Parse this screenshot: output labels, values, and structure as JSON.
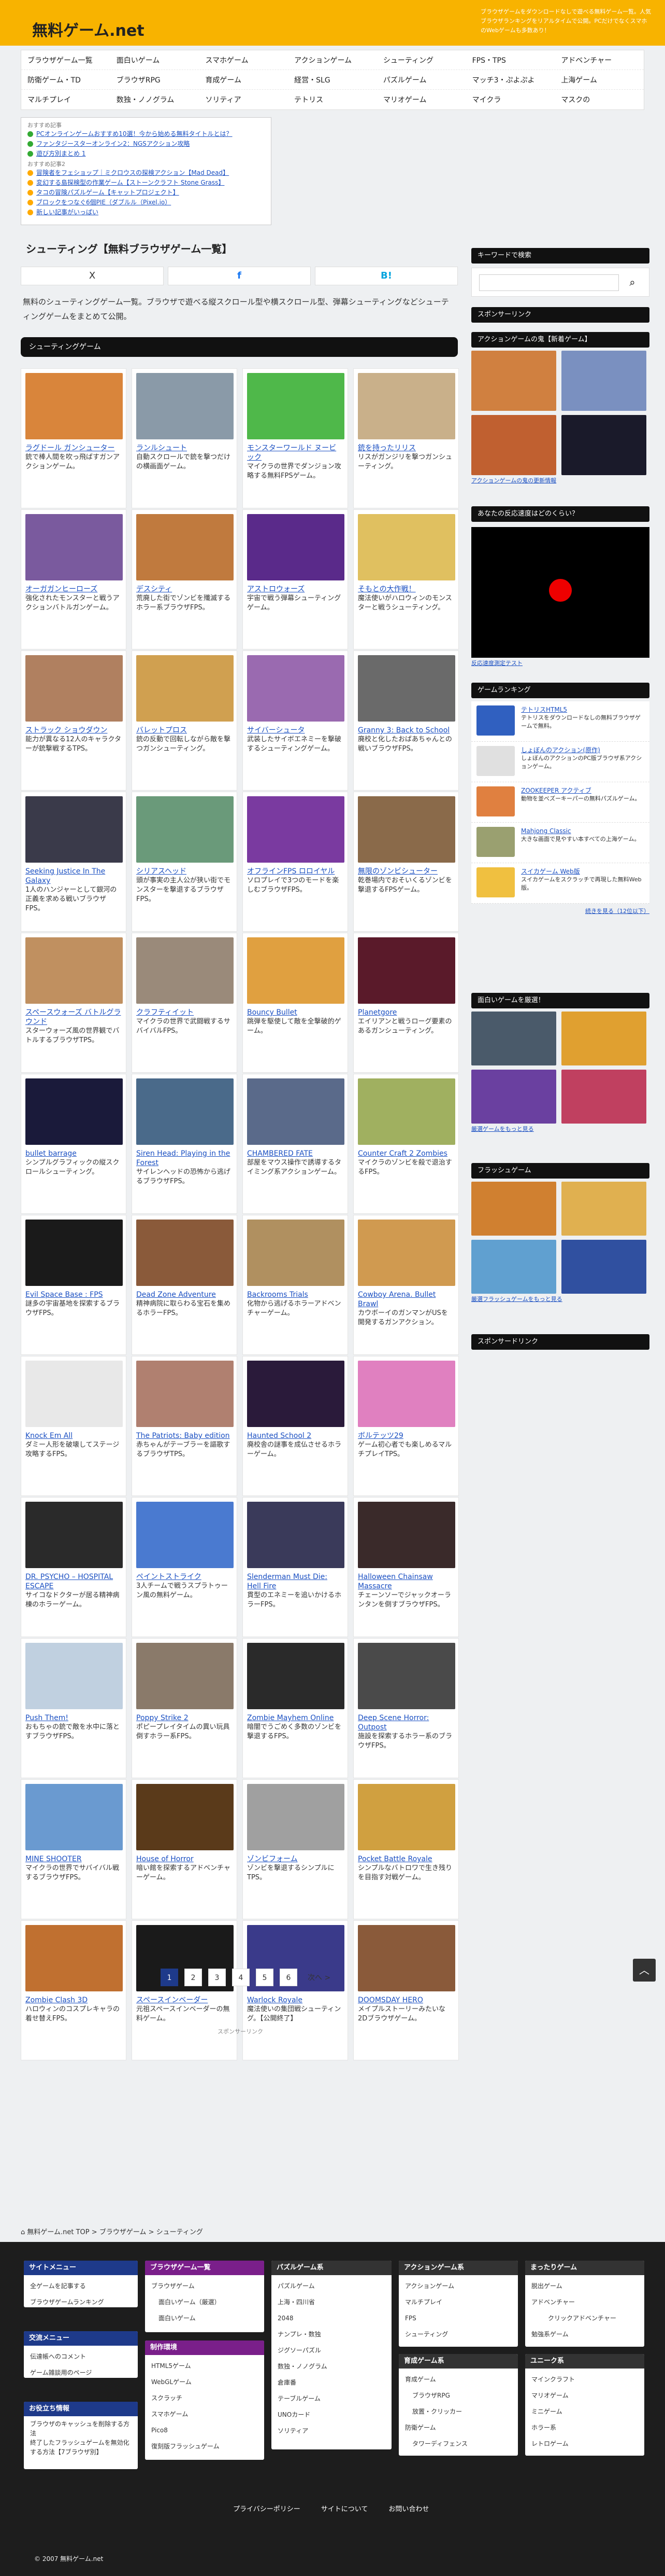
{
  "header": {
    "title": "無料ゲーム.net",
    "tagline": "ブラウザゲームをダウンロードなしで遊べる無料ゲーム一覧。人気ブラウザランキングをリアルタイムで公開。PCだけでなくスマホのWebゲームも多数あり！"
  },
  "gnav": [
    [
      "ブラウザゲーム一覧",
      "面白いゲーム",
      "スマホゲーム",
      "アクションゲーム",
      "シューティング",
      "FPS・TPS",
      "アドベンチャー"
    ],
    [
      "防衛ゲーム・TD",
      "ブラウザRPG",
      "育成ゲーム",
      "経営・SLG",
      "パズルゲーム",
      "マッチ3・ぷよぷよ",
      "上海ゲーム"
    ],
    [
      "マルチプレイ",
      "数独・ノノグラム",
      "ソリティア",
      "テトリス",
      "マリオゲーム",
      "マイクラ",
      "マスクの"
    ]
  ],
  "notice": {
    "head1": "おすすめ記事",
    "items1": [
      {
        "text": "PCオンラインゲームおすすめ10選！今から始める無料タイトルとは？",
        "color": "#33aa33"
      },
      {
        "text": "ファンタジースターオンライン2：NGSアクション攻略",
        "color": "#33aa33"
      },
      {
        "text": "遊び方別まとめ 1",
        "color": "#33aa33"
      }
    ],
    "head2": "おすすめ記事2",
    "items2": [
      {
        "text": "冒険者をフェショップ｜ミクロウスの探検アクション【Mad Dead】",
        "color": "#ffaa00"
      },
      {
        "text": "変幻する島探検型の作業ゲーム【ストーンクラフト Stone Grass】",
        "color": "#ffaa00"
      },
      {
        "text": "タコの冒険パズルゲーム【キャットプロジェクト】",
        "color": "#ffaa00"
      },
      {
        "text": "ブロックをつなぐ6個PIE（ダブルル（Pixel.io）",
        "color": "#ffaa00"
      },
      {
        "text": "新しい記事がいっぱい",
        "color": "#ffaa00"
      }
    ]
  },
  "main": {
    "h1": "シューティング【無料ブラウザゲーム一覧】",
    "share": {
      "x": "X",
      "fb": "f",
      "hb": "B!"
    },
    "intro": "無料のシューティングゲーム一覧。ブラウザで遊べる縦スクロール型や横スクロール型、弾幕シューティングなどシューティングゲームをまとめて公開。",
    "section": "シューティングゲーム"
  },
  "games": [
    {
      "title": "ラグドール ガンシューター",
      "desc": "銃で棒人間を吹っ飛ばすガンアクションゲーム。",
      "color": "#d9853b"
    },
    {
      "title": "ランルシュート",
      "desc": "自動スクロールで銃を撃つだけの横画面ゲーム。",
      "color": "#8a9aa8"
    },
    {
      "title": "モンスターワールド ヌービック",
      "desc": "マイクラの世界でダンジョン攻略する無料FPSゲーム。",
      "color": "#4fb84a"
    },
    {
      "title": "銃を持ったリリス",
      "desc": "リスがガンジリを撃つガンシューティング。",
      "color": "#c9b08a"
    },
    {
      "title": "オーガガンヒーローズ",
      "desc": "強化されたモンスターと戦うアクションバトルガンゲーム。",
      "color": "#7a5a9e"
    },
    {
      "title": "デスシティ",
      "desc": "荒廃した街でゾンビを殲滅するホラー系ブラウザFPS。",
      "color": "#c07a3e"
    },
    {
      "title": "アストロウォーズ",
      "desc": "宇宙で戦う弾幕シューティングゲーム。",
      "color": "#5a2a8a"
    },
    {
      "title": "そもとの大作戦！",
      "desc": "魔法使いがハロウィンのモンスターと戦うシューティング。",
      "color": "#e0c060"
    },
    {
      "title": "ストラック ショウダウン",
      "desc": "能力が異なる12人のキャラクターが銃撃戦するTPS。",
      "color": "#b08060"
    },
    {
      "title": "バレットプロス",
      "desc": "銃の反動で回転しながら敵を撃つガンシューティング。",
      "color": "#d0a050"
    },
    {
      "title": "サイバーシュータ",
      "desc": "武装したサイボエネミーを撃破するシューティングゲーム。",
      "color": "#9a6ab0"
    },
    {
      "title": "Granny 3: Back to School",
      "desc": "廃校と化したおばあちゃんとの戦いブラウザFPS。",
      "color": "#6a6a6a"
    },
    {
      "title": "Seeking Justice In The Galaxy",
      "desc": "1人のハンジャーとして銀河の正義を求める戦いブラウザFPS。",
      "color": "#3a3a4a"
    },
    {
      "title": "シリアスヘッド",
      "desc": "頭が事実の主人公が狭い街でモンスターを撃退するブラウザFPS。",
      "color": "#6a9a7a"
    },
    {
      "title": "オフラインFPS ロロイヤル",
      "desc": "ソロプレイで3つのモードを楽しむブラウザFPS。",
      "color": "#7a3aa0"
    },
    {
      "title": "無限のゾンビシューター",
      "desc": "乾巻場内でおそいくるゾンビを撃退するFPSゲーム。",
      "color": "#8a6a4a"
    },
    {
      "title": "スペースウォーズ バトルグラウンド",
      "desc": "スターウォーズ風の世界観でバトルするブラウザTPS。",
      "color": "#c09060"
    },
    {
      "title": "クラフティイット",
      "desc": "マイクラの世界で武闘戦するサバイバルFPS。",
      "color": "#9a8a7a"
    },
    {
      "title": "Bouncy Bullet",
      "desc": "跳弾を駆使して敵を全撃破的ゲーム。",
      "color": "#e0a040"
    },
    {
      "title": "Planetgore",
      "desc": "エイリアンと戦うローグ要素のあるガンシューティング。",
      "color": "#5a1a2a"
    },
    {
      "title": "bullet barrage",
      "desc": "シンプルグラフィックの縦スクロールシューティング。",
      "color": "#1a1a3a"
    },
    {
      "title": "Siren Head: Playing in the Forest",
      "desc": "サイレンヘッドの恐怖から逃げるブラウザFPS。",
      "color": "#4a6a8a"
    },
    {
      "title": "CHAMBERED FATE",
      "desc": "部屋をマウス操作で誘導するタイミング系アクションゲーム。",
      "color": "#5a6a8a"
    },
    {
      "title": "Counter Craft 2 Zombies",
      "desc": "マイクラのゾンビを殺で退治するFPS。",
      "color": "#a0b060"
    },
    {
      "title": "Evil Space Base : FPS",
      "desc": "謎多の宇宙基地を探索するブラウザFPS。",
      "color": "#1a1a1a"
    },
    {
      "title": "Dead Zone Adventure",
      "desc": "精神病院に取らわる宝石を集めるホラーFPS。",
      "color": "#8a5a3a"
    },
    {
      "title": "Backrooms Trials",
      "desc": "化物から逃げるホラーアドベンチャーゲーム。",
      "color": "#b09060"
    },
    {
      "title": "Cowboy Arena. Bullet Brawl",
      "desc": "カウボーイのガンマンがUSを開発するガンアクション。",
      "color": "#d09a50"
    },
    {
      "title": "Knock Em All",
      "desc": "ダミー人形を破壊してステージ攻略するFPS。",
      "color": "#e8e8e8"
    },
    {
      "title": "The Patriots: Baby edition",
      "desc": "赤ちゃんがテーブラーを謳歌するブラウザTPS。",
      "color": "#b08070"
    },
    {
      "title": "Haunted School 2",
      "desc": "廃校舎の謎事を成仏させるホラーゲーム。",
      "color": "#2a1a3a"
    },
    {
      "title": "ボルテッツ29",
      "desc": "ゲーム初心者でも楽しめるマルチプレイTPS。",
      "color": "#e080c0"
    },
    {
      "title": "DR. PSYCHO – HOSPITAL ESCAPE",
      "desc": "サイコなドクターが居る精神病棟のホラーゲーム。",
      "color": "#2a2a2a"
    },
    {
      "title": "ペイントストライク",
      "desc": "3人チームで戦うスプラトゥーン風の無料ゲーム。",
      "color": "#4a7ad0"
    },
    {
      "title": "Slenderman Must Die: Hell Fire",
      "desc": "貫型のエネミーを追いかけるホラーFPS。",
      "color": "#3a3a5a"
    },
    {
      "title": "Halloween Chainsaw Massacre",
      "desc": "チェーンソーでジャックオーランタンを倒すブラウザFPS。",
      "color": "#3a2a2a"
    },
    {
      "title": "Push Them!",
      "desc": "おもちゃの銃で敵を水中に落とすブラウザFPS。",
      "color": "#c0d0e0"
    },
    {
      "title": "Poppy Strike 2",
      "desc": "ポピープレイタイムの異い玩具倒すホラー系FPS。",
      "color": "#8a7a6a"
    },
    {
      "title": "Zombie Mayhem Online",
      "desc": "暗闇でうごめく多数のゾンビを撃退するFPS。",
      "color": "#2a2a2a"
    },
    {
      "title": "Deep Scene Horror: Outpost",
      "desc": "施設を探索するホラー系のブラウザFPS。",
      "color": "#4a4a4a"
    },
    {
      "title": "MINE SHOOTER",
      "desc": "マイクラの世界でサバイバル戦するブラウザFPS。",
      "color": "#6a9ad0"
    },
    {
      "title": "House of Horror",
      "desc": "暗い館を探索するアドベンチャーゲーム。",
      "color": "#5a3a1a"
    },
    {
      "title": "ゾンビフォーム",
      "desc": "ゾンビを撃退するシンプルにTPS。",
      "color": "#a0a0a0"
    },
    {
      "title": "Pocket Battle Royale",
      "desc": "シンプルなバトロワで生き残りを目指す対戦ゲーム。",
      "color": "#d0a040"
    },
    {
      "title": "Zombie Clash 3D",
      "desc": "ハロウィンのコスプレキャラの着せ替えFPS。",
      "color": "#c07030"
    },
    {
      "title": "スペースインベーダー",
      "desc": "元祖スペースインベーダーの無料ゲーム。",
      "color": "#1a1a1a"
    },
    {
      "title": "Warlock Royale",
      "desc": "魔法使いの集団戦シューティング。【公開終了】",
      "color": "#3a3a8a"
    },
    {
      "title": "DOOMSDAY HERO",
      "desc": "メイプルストーリーみたいな2Dブラウザゲーム。",
      "color": "#8a5a3a"
    }
  ],
  "pager": {
    "pages": [
      "1",
      "2",
      "3",
      "4",
      "5",
      "6"
    ],
    "next": "次へ >"
  },
  "sponsor_label": "スポンサーリンク",
  "sidebar": {
    "search_title": "キーワードで検索",
    "search_placeholder": "",
    "spons1": "スポンサーリンク",
    "new_title": "アクションゲームの鬼【新着ゲーム】",
    "new_link": "アクションゲームの鬼の更新情報",
    "reflex_title": "あなたの反応速度はどのくらい？",
    "reflex_link": "反応速度測定テスト",
    "rank_title": "ゲームランキング",
    "rank": [
      {
        "t": "テトリスHTML5",
        "d": "テトリスをダウンロードなしの無料ブラウザゲームで無料。",
        "c": "#3060c0"
      },
      {
        "t": "しょぼんのアクション(原作)",
        "d": "しょぼんのアクションのPC版ブラウザ系アクションゲーム。",
        "c": "#e0e0e0"
      },
      {
        "t": "ZOOKEEPER アクティブ",
        "d": "動物を並べズーキーパーの無料パズルゲーム。",
        "c": "#e08040"
      },
      {
        "t": "Mahjong Classic",
        "d": "大きな画面で見やすい本すべての上海ゲーム。",
        "c": "#9aa070"
      },
      {
        "t": "スイカゲーム Web版",
        "d": "スイカゲームをスクラッチで再現した無料Web版。",
        "c": "#f0c040"
      }
    ],
    "rank_more": "続きを見る（12位以下）",
    "fun_title": "面白いゲームを厳選！",
    "fun_link": "厳選ゲームをもっと見る",
    "flash_title": "フラッシュゲーム",
    "flash_link": "厳選フラッシュゲームをもっと見る",
    "spons2": "スポンサードリンク"
  },
  "breadcrumb": {
    "home": "無料ゲーム.net TOP",
    "b1": "ブラウザゲーム",
    "b2": "シューティング"
  },
  "footer": {
    "site_menu": {
      "head": "サイトメニュー",
      "items": [
        "全ゲームを記事する",
        "ブラウザゲームランキング"
      ]
    },
    "exchange": {
      "head": "交流メニュー",
      "items": [
        "伝達帳へのコメント",
        "ゲーム雑談用のページ"
      ]
    },
    "info": {
      "head": "お役立ち情報",
      "items": [
        "ブラウザのキャッシュを削除する方法",
        "終了したフラッシュゲームを無効化する方法【7ブラウザ別】"
      ]
    },
    "browser": {
      "head": "ブラウザゲーム一覧",
      "items": [
        "ブラウザゲーム",
        "面白いゲーム（厳選）",
        "面白いゲーム"
      ]
    },
    "engine": {
      "head": "制作環境",
      "items": [
        "HTML5ゲーム",
        "WebGLゲーム",
        "スクラッチ",
        "スマホゲーム",
        "Pico8",
        "復刻版フラッシュゲーム"
      ]
    },
    "puzzle": {
      "head": "パズルゲーム系",
      "items": [
        "パズルゲーム",
        "上海・四川省",
        "2048",
        "ナンプレ・数独",
        "ジグソーパズル",
        "数独・ノノグラム",
        "倉庫番",
        "テーブルゲーム",
        "UNOカード",
        "ソリティア"
      ]
    },
    "action": {
      "head": "アクションゲーム系",
      "items": [
        "アクションゲーム",
        "マルチプレイ",
        "FPS",
        "シューティング"
      ]
    },
    "raise": {
      "head": "育成ゲーム系",
      "items": [
        "育成ゲーム",
        "ブラウザRPG",
        "放置・クリッカー",
        "防衛ゲーム",
        "タワーディフェンス"
      ]
    },
    "mario": {
      "head": "まったりゲーム",
      "items": [
        "脱出ゲーム",
        "アドベンチャー",
        "クリックアドベンチャー",
        "勉強系ゲーム"
      ]
    },
    "unique": {
      "head": "ユニーク系",
      "items": [
        "マインクラフト",
        "マリオゲーム",
        "ミニゲーム",
        "ホラー系",
        "レトロゲーム"
      ]
    },
    "links": [
      "プライバシーポリシー",
      "サイトについて",
      "お問い合わせ"
    ],
    "copyright": "© 2007 無料ゲーム.net"
  }
}
